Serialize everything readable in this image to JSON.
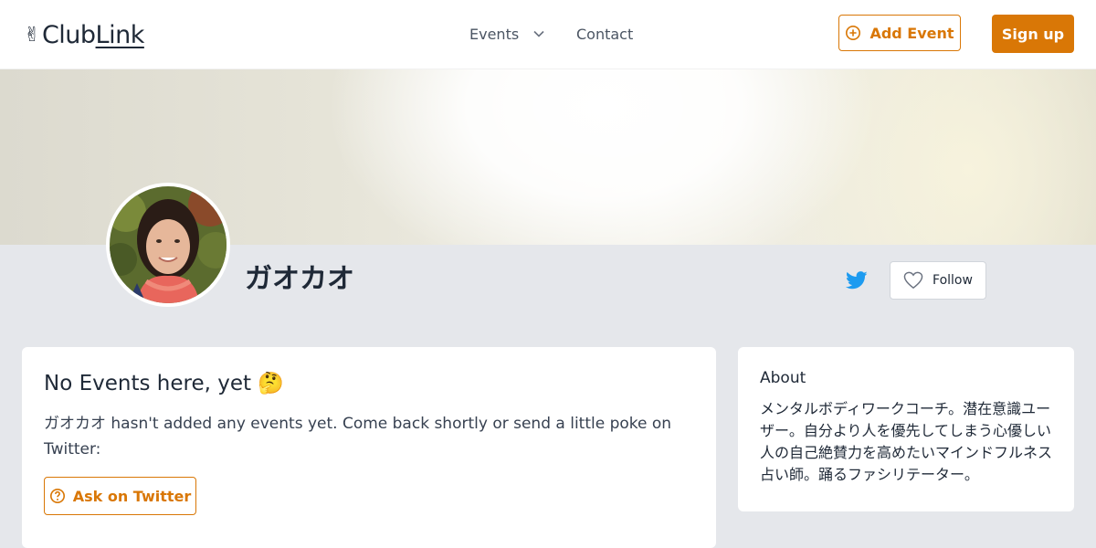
{
  "header": {
    "logo_prefix": "Club",
    "logo_link": "Link",
    "nav": {
      "events": "Events",
      "contact": "Contact"
    },
    "add_event": "Add Event",
    "sign_up": "Sign up"
  },
  "profile": {
    "name": "ガオカオ",
    "follow": "Follow"
  },
  "events_card": {
    "title": "No Events here, yet 🤔",
    "message": "ガオカオ hasn't added any events yet. Come back shortly or send a little poke on Twitter:",
    "ask_button": "Ask on Twitter"
  },
  "about_card": {
    "title": "About",
    "text": "メンタルボディワークコーチ。潜在意識ユーザー。自分より人を優先してしまう心優しい人の自己絶賛力を高めたいマインドフルネス占い師。踊るファシリテーター。"
  },
  "colors": {
    "accent": "#d97706",
    "twitter": "#1d9bf0",
    "page_bg": "#e5e7eb"
  },
  "icons": [
    "victory-hand-icon",
    "chevron-down-icon",
    "plus-circle-icon",
    "twitter-icon",
    "heart-icon",
    "question-circle-icon"
  ]
}
